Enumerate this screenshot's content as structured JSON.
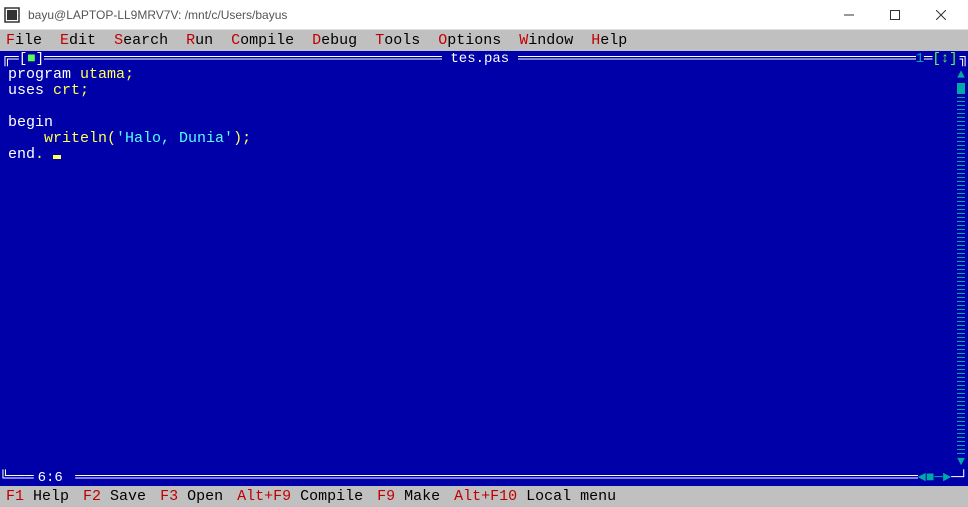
{
  "window": {
    "title": "bayu@LAPTOP-LL9MRV7V: /mnt/c/Users/bayus"
  },
  "menu": {
    "file": {
      "hot": "F",
      "rest": "ile"
    },
    "edit": {
      "hot": "E",
      "rest": "dit"
    },
    "search": {
      "hot": "S",
      "rest": "earch"
    },
    "run": {
      "hot": "R",
      "rest": "un"
    },
    "compile": {
      "hot": "C",
      "rest": "ompile"
    },
    "debug": {
      "hot": "D",
      "rest": "ebug"
    },
    "tools": {
      "hot": "T",
      "rest": "ools"
    },
    "options": {
      "hot": "O",
      "rest": "ptions"
    },
    "window": {
      "hot": "W",
      "rest": "indow"
    },
    "help": {
      "hot": "H",
      "rest": "elp"
    }
  },
  "editor": {
    "filename": "tes.pas",
    "window_number": "1",
    "cursor_position": "6:6",
    "lines": {
      "l1a": "program",
      "l1b": " utama;",
      "l2a": "uses",
      "l2b": " crt;",
      "l3": "",
      "l4": "begin",
      "l5a": "    writeln(",
      "l5b": "'Halo, Dunia'",
      "l5c": ");",
      "l6a": "end",
      "l6b": ". "
    }
  },
  "status": {
    "help": {
      "key": "F1",
      "label": " Help"
    },
    "save": {
      "key": "F2",
      "label": " Save"
    },
    "open": {
      "key": "F3",
      "label": " Open"
    },
    "compile": {
      "key": "Alt+F9",
      "label": " Compile"
    },
    "make": {
      "key": "F9",
      "label": " Make"
    },
    "localmenu": {
      "key": "Alt+F10",
      "label": " Local menu"
    }
  }
}
